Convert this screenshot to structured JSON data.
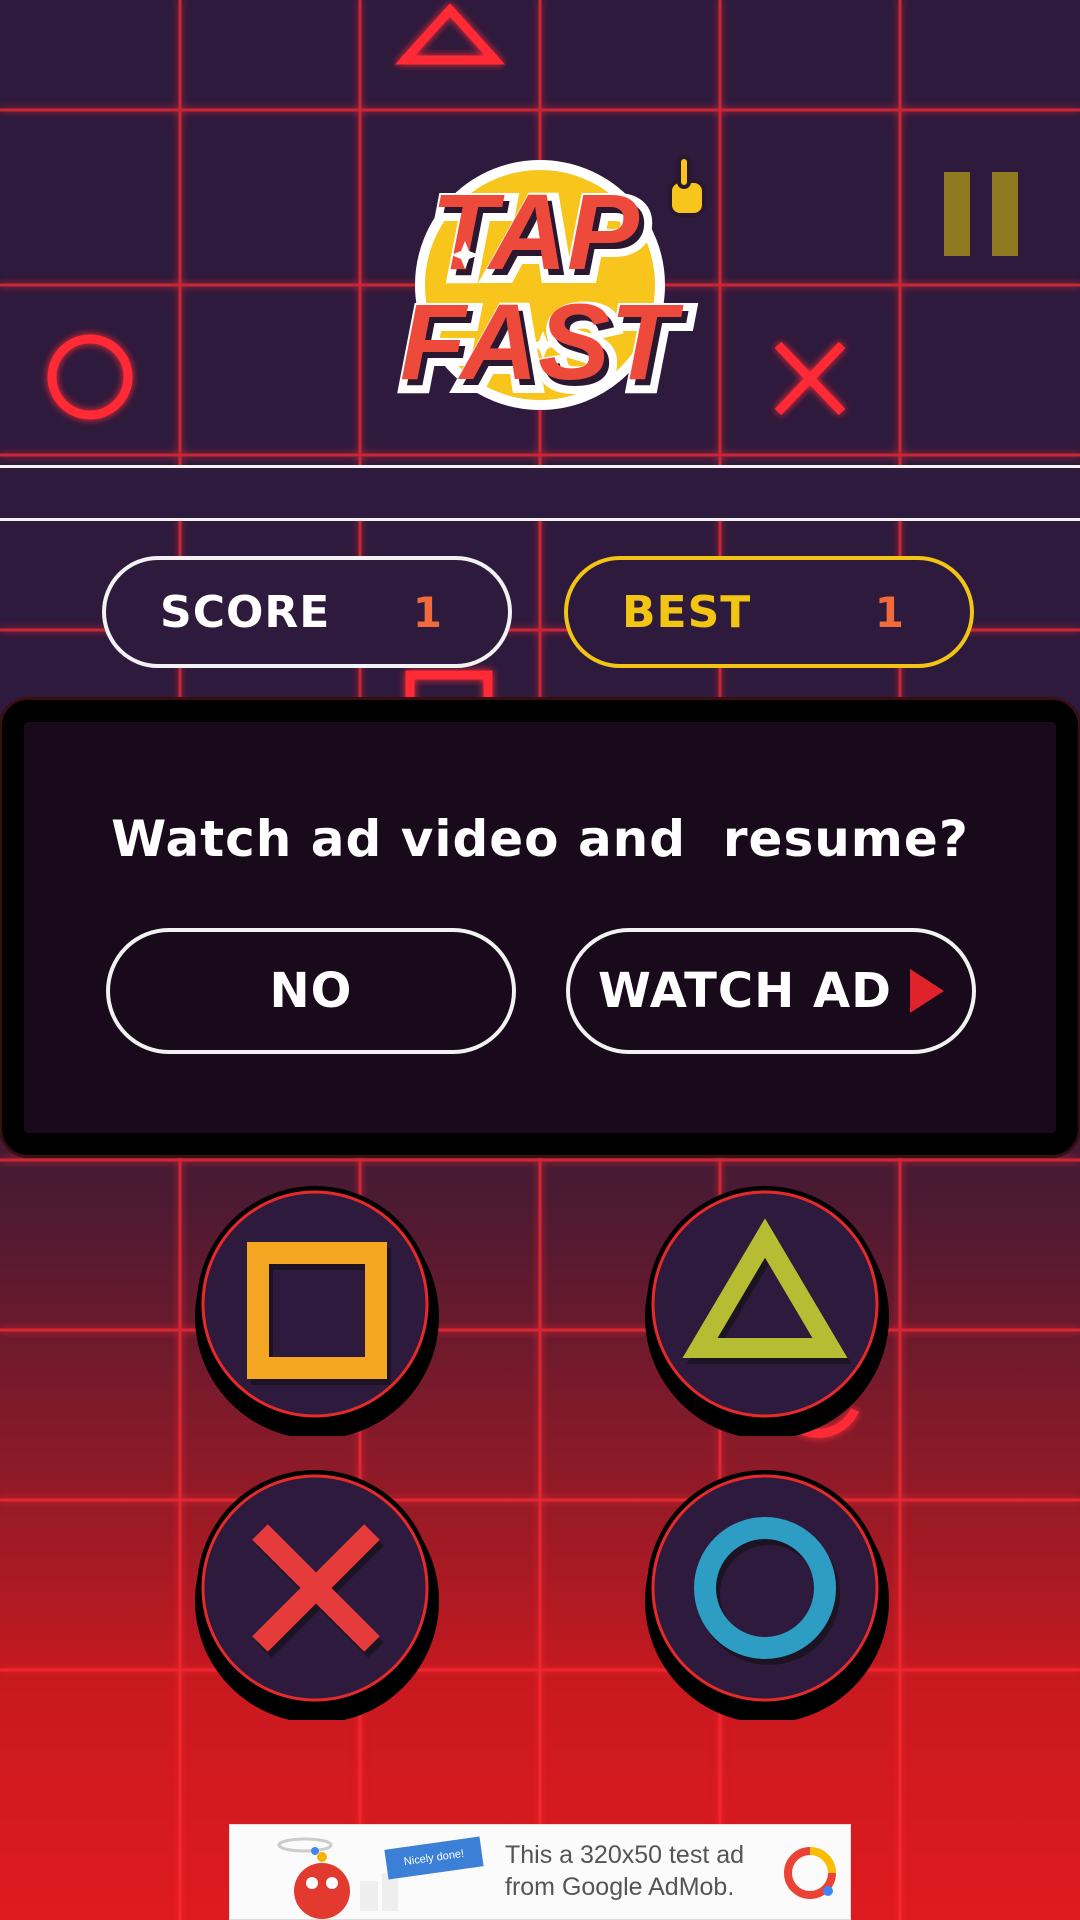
{
  "game": {
    "logo_line1": "TAP",
    "logo_line2": "FAST"
  },
  "score": {
    "label": "SCORE",
    "value": "1"
  },
  "best": {
    "label": "BEST",
    "value": "1"
  },
  "dialog": {
    "question": "Watch ad video and  resume?",
    "no_label": "NO",
    "watch_label": "WATCH AD"
  },
  "controls": [
    {
      "name": "square",
      "color": "#f5a623"
    },
    {
      "name": "triangle",
      "color": "#b7bd32"
    },
    {
      "name": "cross",
      "color": "#e63b3b"
    },
    {
      "name": "circle",
      "color": "#2e9dc4"
    }
  ],
  "ad": {
    "text": "This a 320x50 test ad from Google AdMob.",
    "badge": "Nicely done!"
  },
  "colors": {
    "grid_line": "#ff2a34",
    "accent_yellow": "#f2c414",
    "score_value": "#f06a3a"
  }
}
